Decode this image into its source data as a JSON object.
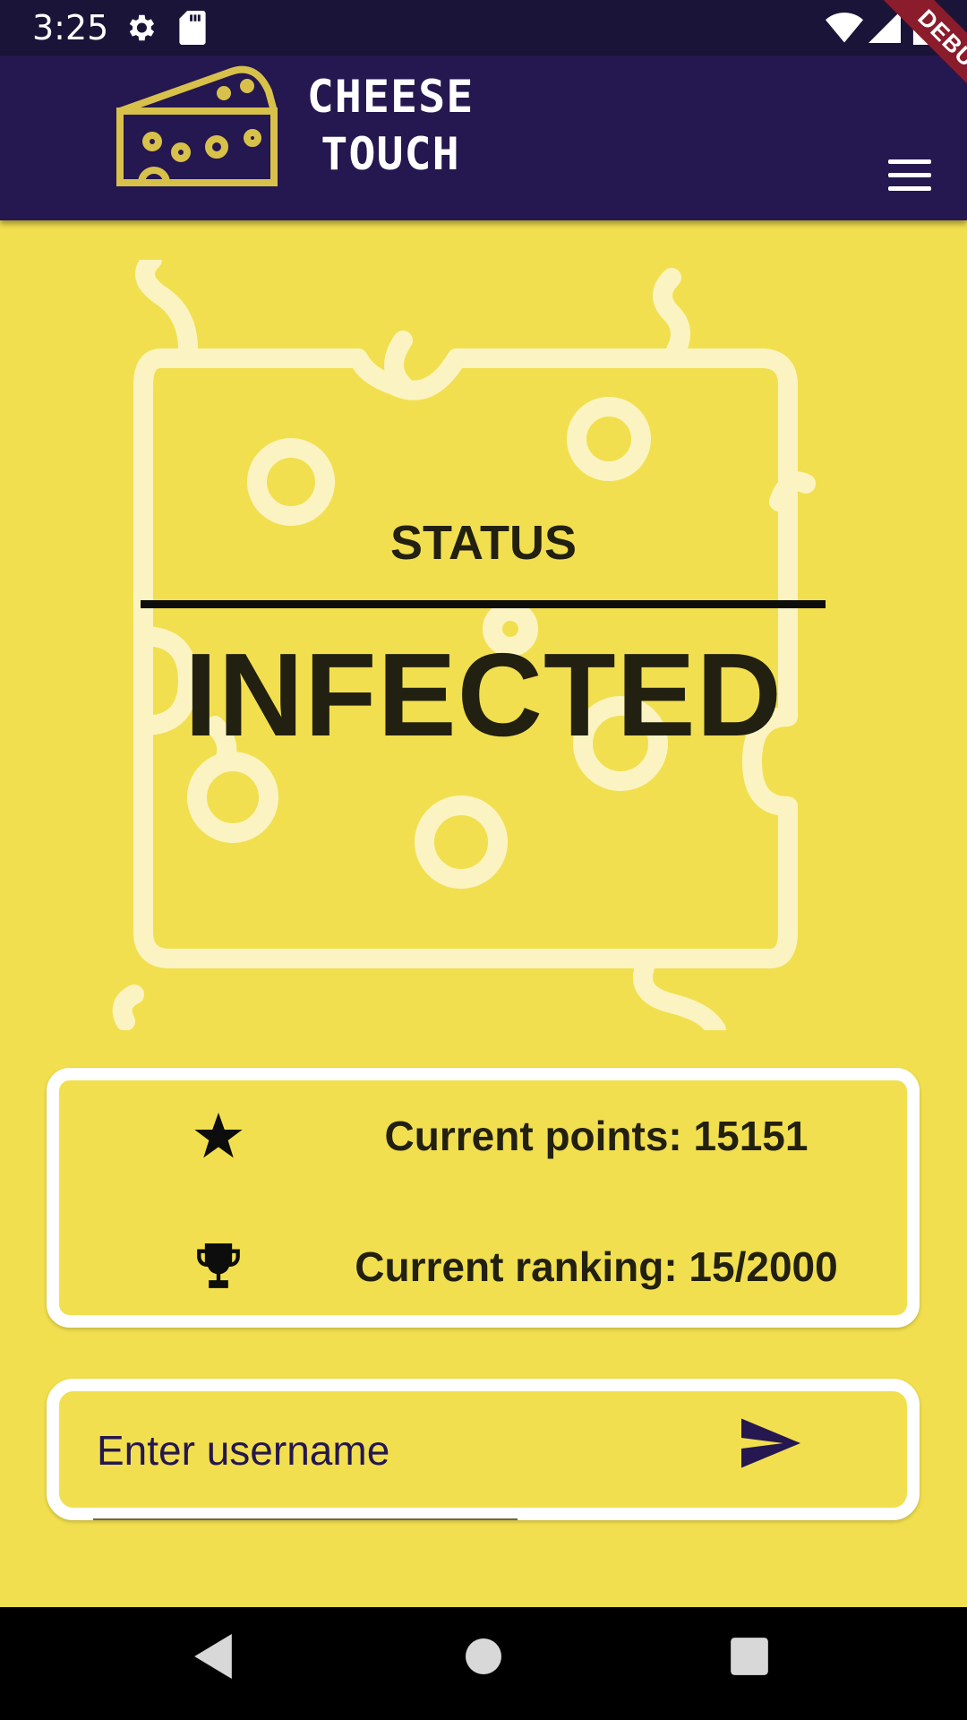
{
  "status_bar": {
    "time": "3:25",
    "icons": [
      "gear-icon",
      "sd-card-icon",
      "wifi-icon",
      "signal-icon",
      "battery-icon"
    ]
  },
  "app_bar": {
    "title_line1": "CHEESE",
    "title_line2": "TOUCH",
    "logo": "cheese-logo-icon",
    "menu_icon": "hamburger-menu-icon",
    "debug_banner": "DEBUG"
  },
  "status": {
    "label": "STATUS",
    "value": "INFECTED"
  },
  "stats": {
    "points_label": "Current points: 15151",
    "ranking_label": "Current ranking: 15/2000",
    "points_icon": "star-icon",
    "ranking_icon": "trophy-icon"
  },
  "username": {
    "placeholder": "Enter username",
    "value": "",
    "submit_icon": "send-icon"
  },
  "nav_bar": {
    "buttons": [
      "back-icon",
      "home-icon",
      "recents-icon"
    ]
  },
  "colors": {
    "background": "#f2df4f",
    "app_bar": "#25174f",
    "status_bar": "#1a1438",
    "card_border": "#ffffff",
    "text_dark": "#222010",
    "accent": "#25174f",
    "debug_banner": "#8a1c2b"
  }
}
